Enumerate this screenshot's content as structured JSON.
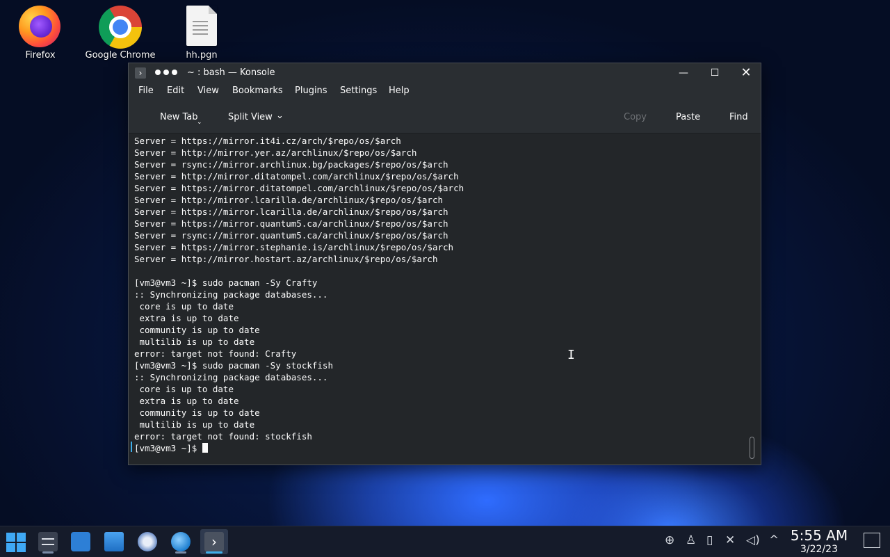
{
  "desktop": {
    "icons": [
      {
        "label": "Firefox",
        "icon": "firefox-icon"
      },
      {
        "label": "Google Chrome",
        "icon": "chrome-icon"
      },
      {
        "label": "hh.pgn",
        "icon": "text-file-icon"
      }
    ]
  },
  "window": {
    "title": "~ : bash — Konsole",
    "menu": [
      "File",
      "Edit",
      "View",
      "Bookmarks",
      "Plugins",
      "Settings",
      "Help"
    ],
    "toolbar": {
      "new_tab": "New Tab",
      "split_view": "Split View",
      "copy": "Copy",
      "paste": "Paste",
      "find": "Find"
    },
    "terminal_lines": [
      "Server = https://mirror.it4i.cz/arch/$repo/os/$arch",
      "Server = http://mirror.yer.az/archlinux/$repo/os/$arch",
      "Server = rsync://mirror.archlinux.bg/packages/$repo/os/$arch",
      "Server = http://mirror.ditatompel.com/archlinux/$repo/os/$arch",
      "Server = https://mirror.ditatompel.com/archlinux/$repo/os/$arch",
      "Server = http://mirror.lcarilla.de/archlinux/$repo/os/$arch",
      "Server = https://mirror.lcarilla.de/archlinux/$repo/os/$arch",
      "Server = https://mirror.quantum5.ca/archlinux/$repo/os/$arch",
      "Server = rsync://mirror.quantum5.ca/archlinux/$repo/os/$arch",
      "Server = https://mirror.stephanie.is/archlinux/$repo/os/$arch",
      "Server = http://mirror.hostart.az/archlinux/$repo/os/$arch",
      "",
      "[vm3@vm3 ~]$ sudo pacman -Sy Crafty",
      ":: Synchronizing package databases...",
      " core is up to date",
      " extra is up to date",
      " community is up to date",
      " multilib is up to date",
      "error: target not found: Crafty",
      "[vm3@vm3 ~]$ sudo pacman -Sy stockfish",
      ":: Synchronizing package databases...",
      " core is up to date",
      " extra is up to date",
      " community is up to date",
      " multilib is up to date",
      "error: target not found: stockfish"
    ],
    "prompt": "[vm3@vm3 ~]$ "
  },
  "taskbar": {
    "apps": [
      "start-menu-icon",
      "settings-icon",
      "store-icon",
      "file-manager-icon",
      "system-settings-icon",
      "browser-icon",
      "konsole-icon"
    ],
    "clock": {
      "time": "5:55 AM",
      "date": "3/22/23"
    }
  }
}
